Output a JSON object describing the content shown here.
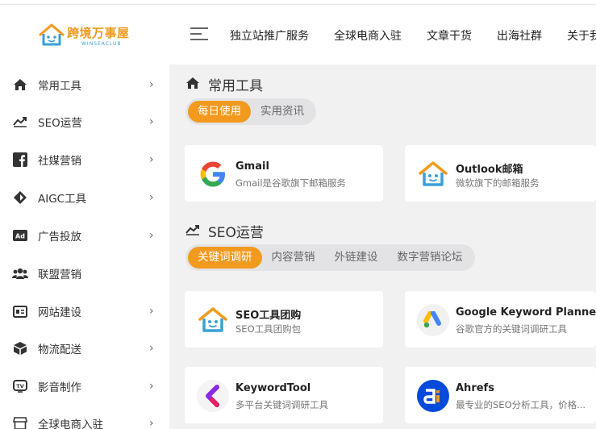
{
  "brand": {
    "name": "跨境万事屋",
    "sub": "WINSEACLUB"
  },
  "nav": [
    "独立站推广服务",
    "全球电商入驻",
    "文章干货",
    "出海社群",
    "关于我"
  ],
  "sidebar": [
    {
      "label": "常用工具",
      "icon": "home-icon"
    },
    {
      "label": "SEO运营",
      "icon": "trend-icon"
    },
    {
      "label": "社媒营销",
      "icon": "facebook-icon"
    },
    {
      "label": "AIGC工具",
      "icon": "diamond-icon"
    },
    {
      "label": "广告投放",
      "icon": "ad-icon"
    },
    {
      "label": "联盟营销",
      "icon": "people-icon"
    },
    {
      "label": "网站建设",
      "icon": "website-icon"
    },
    {
      "label": "物流配送",
      "icon": "box-icon"
    },
    {
      "label": "影音制作",
      "icon": "tv-icon"
    },
    {
      "label": "全球电商入驻",
      "icon": "shop-icon"
    }
  ],
  "sections": [
    {
      "title": "常用工具",
      "tabs": [
        "每日使用",
        "实用资讯"
      ],
      "cards": [
        {
          "title": "Gmail",
          "desc": "Gmail是谷歌旗下邮箱服务"
        },
        {
          "title": "Outlook邮箱",
          "desc": "微软旗下的邮箱服务"
        }
      ]
    },
    {
      "title": "SEO运营",
      "tabs": [
        "关键词调研",
        "内容营销",
        "外链建设",
        "数字营销论坛"
      ],
      "cards": [
        {
          "title": "SEO工具团购",
          "desc": "SEO工具团购包"
        },
        {
          "title": "Google Keyword Planner",
          "desc": "谷歌官方的关键词调研工具"
        },
        {
          "title": "KeywordTool",
          "desc": "多平台关键词调研工具"
        },
        {
          "title": "Ahrefs",
          "desc": "最专业的SEO分析工具，价格..."
        }
      ]
    }
  ],
  "colors": {
    "accent": "#f29a1e",
    "blue": "#3aa0d8"
  }
}
